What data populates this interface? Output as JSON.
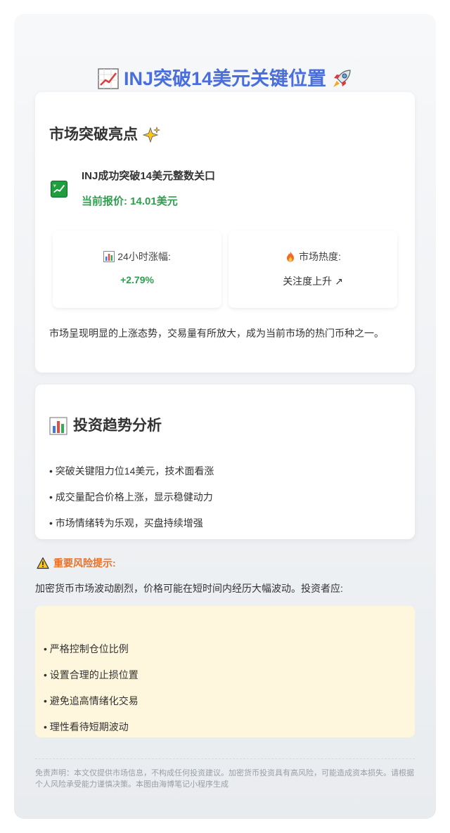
{
  "header": {
    "title": "INJ突破14美元关键位置",
    "left_icon": "chart-increasing-icon",
    "right_icon": "rocket-icon"
  },
  "highlights": {
    "heading": "市场突破亮点",
    "heading_icon": "sparkles-icon",
    "headline": "INJ成功突破14美元整数关口",
    "headline_icon": "chart-yen-check-icon",
    "price": "当前报价: 14.01美元",
    "stats": [
      {
        "label": "24小时涨幅:",
        "value": "+2.79%",
        "icon": "bar-chart-icon"
      },
      {
        "label": "市场热度:",
        "value": "关注度上升 ↗",
        "icon": "fire-icon"
      }
    ],
    "summary": "市场呈现明显的上涨态势，交易量有所放大，成为当前市场的热门币种之一。"
  },
  "analysis": {
    "heading": "投资趋势分析",
    "heading_icon": "bar-chart-icon",
    "items": [
      "• 突破关键阻力位14美元，技术面看涨",
      "• 成交量配合价格上涨，显示稳健动力",
      "• 市场情绪转为乐观，买盘持续增强"
    ]
  },
  "risk": {
    "heading": "重要风险提示:",
    "heading_icon": "warning-icon",
    "intro": "加密货币市场波动剧烈，价格可能在短时间内经历大幅波动。投资者应:",
    "items": [
      "• 严格控制仓位比例",
      "• 设置合理的止损位置",
      "• 避免追高情绪化交易",
      "• 理性看待短期波动"
    ]
  },
  "disclaimer": "免责声明：本文仅提供市场信息，不构成任何投资建议。加密货币投资具有高风险，可能造成资本损失。请根据个人风险承受能力谨慎决策。本图由海博笔记小程序生成",
  "colors": {
    "title": "#4a6fdc",
    "positive": "#2f9e4f",
    "warning": "#e8712b",
    "risk_box": "#fef6dd"
  }
}
